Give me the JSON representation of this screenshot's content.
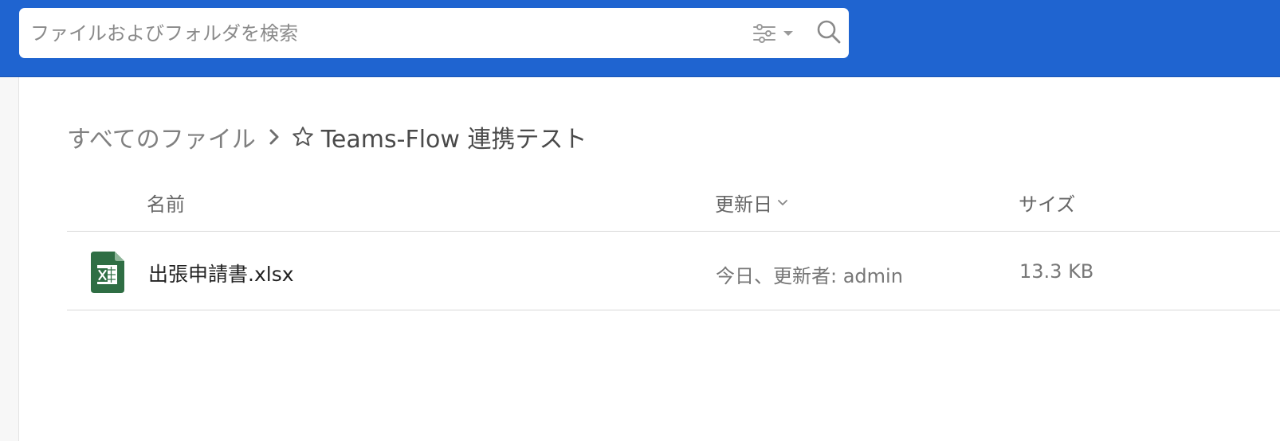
{
  "search": {
    "placeholder": "ファイルおよびフォルダを検索",
    "value": ""
  },
  "icons": {
    "filter": "sliders-icon",
    "filter_dropdown": "caret-down-icon",
    "search": "search-icon",
    "breadcrumb_separator": "chevron-right-icon",
    "favorite": "star-outline-icon",
    "sort": "chevron-down-icon",
    "file": "excel-file-icon"
  },
  "breadcrumb": {
    "root": "すべてのファイル",
    "current": "Teams-Flow 連携テスト"
  },
  "table": {
    "headers": {
      "name": "名前",
      "updated": "更新日",
      "size": "サイズ"
    },
    "rows": [
      {
        "name": "出張申請書.xlsx",
        "updated": "今日、更新者: admin",
        "size": "13.3 KB"
      }
    ]
  },
  "colors": {
    "topbar": "#1f64d0",
    "excel_icon": "#2f6e44"
  }
}
